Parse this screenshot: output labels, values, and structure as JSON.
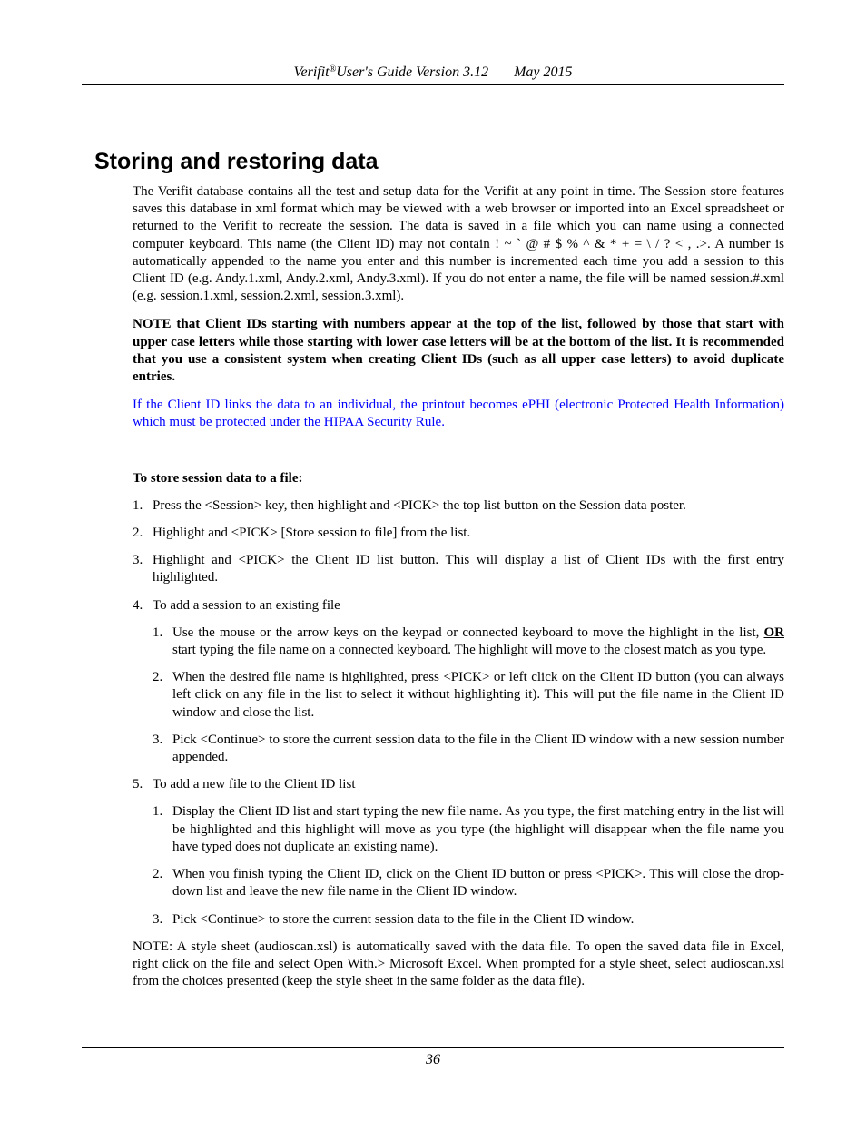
{
  "header": {
    "product": "Verifit",
    "registered_mark": "®",
    "guide": "User's Guide Version 3.12",
    "date": "May 2015"
  },
  "title": "Storing and restoring data",
  "intro_paragraph": "The Verifit database contains all the test and setup data for the Verifit at any point in time. The Session store features saves this database in xml format which may be viewed with a web browser or imported into an Excel spreadsheet or returned to the Verifit to recreate the session. The data is saved in a file which you can name using a connected computer keyboard. This name (the Client ID) may not contain ! ~ ` @ # $ % ^ & * + = \\ / ? < , .>. A number is automatically appended to the name you enter and this number is incremented each time you add a session to this Client ID (e.g. Andy.1.xml, Andy.2.xml, Andy.3.xml). If you do not enter a name, the file will be named session.#.xml (e.g. session.1.xml, session.2.xml, session.3.xml).",
  "note_bold": "NOTE that Client IDs starting with numbers appear at the top of the list, followed by those that start with upper case letters while those starting with lower case letters will be at the bottom of the list. It is recommended that you use a consistent system when creating Client IDs (such as all upper case letters) to avoid duplicate entries.",
  "hipaa_note": {
    "text": "If the Client ID links the data to an individual, the printout becomes ePHI (electronic Protected Health Information) which must be protected under the HIPAA Security Rule.",
    "color": "#0000ff"
  },
  "procedure": {
    "heading": "To store session data to a file:",
    "steps": [
      {
        "num": "1.",
        "text": "Press the <Session> key, then highlight and <PICK> the top list button on the Session data poster."
      },
      {
        "num": "2.",
        "text": "Highlight and <PICK> [Store session to file] from the list."
      },
      {
        "num": "3.",
        "text": "Highlight and <PICK> the Client ID list button. This will display a list of Client IDs with the first entry highlighted."
      },
      {
        "num": "4.",
        "text": "To add a session to an existing file",
        "substeps": [
          {
            "num": "1.",
            "text_before": "Use the mouse or the arrow keys on the keypad or connected keyboard to move the highlight in the list, ",
            "emphasis": "OR",
            "text_after": " start typing the file name on a connected keyboard. The highlight will move to the closest match as you type."
          },
          {
            "num": "2.",
            "text": "When the desired file name is highlighted, press <PICK> or left click on the Client ID button (you can always left click on any file in the list to select it without highlighting it). This will put the file name in the Client ID window and close the list."
          },
          {
            "num": "3.",
            "text": "Pick <Continue> to store the current session data to the file in the Client ID window with a new session number appended."
          }
        ]
      },
      {
        "num": "5.",
        "text": "To add a new file to the Client ID list",
        "substeps": [
          {
            "num": "1.",
            "text": "Display the Client ID list and start typing the new file name. As you  type, the first matching entry in the list will be highlighted and this highlight will move as you type (the highlight will disappear when the file name you have typed does not duplicate an existing name)."
          },
          {
            "num": "2.",
            "text": "When you finish typing the Client ID, click on the Client ID button or press <PICK>. This will close the drop-down list and leave the new file name in the Client ID window."
          },
          {
            "num": "3.",
            "text": "Pick <Continue> to store the current session data to the file in the Client ID window."
          }
        ]
      }
    ]
  },
  "final_note": "NOTE: A style sheet (audioscan.xsl) is automatically saved with the data file. To open the saved data file in Excel, right click on the file and select Open With.> Microsoft Excel.  When prompted for a style sheet, select audioscan.xsl from the choices presented (keep the style sheet in the same folder as the data file).",
  "footer": {
    "page_number": "36"
  }
}
